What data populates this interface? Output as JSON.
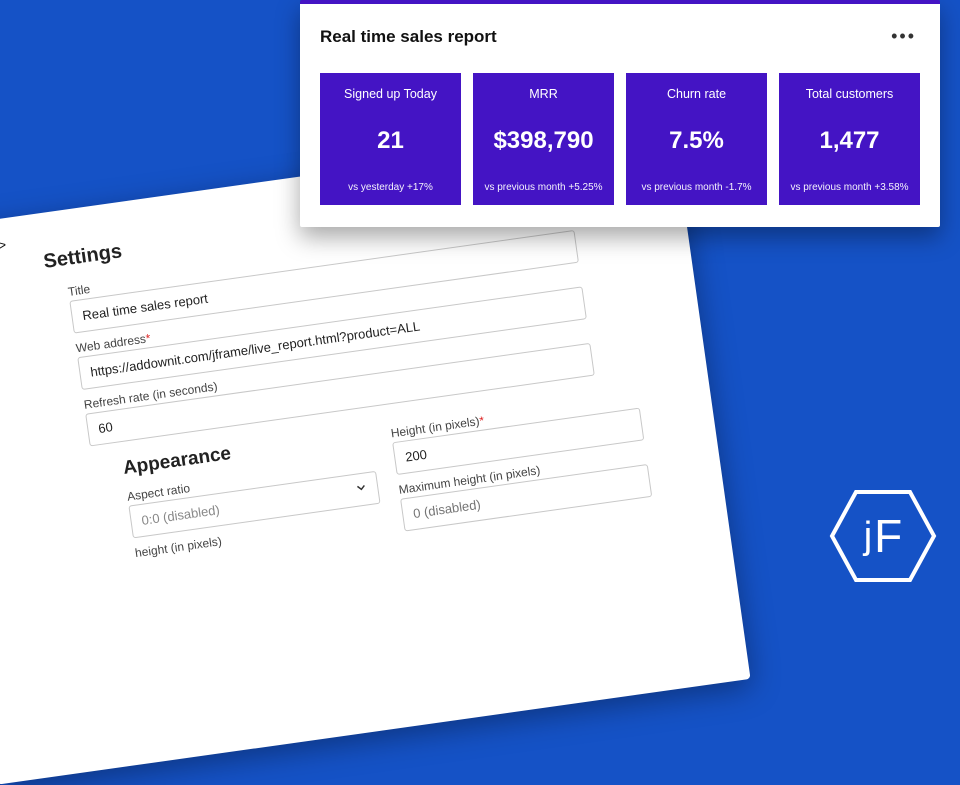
{
  "settings": {
    "tag": "<jframe>",
    "heading": "Settings",
    "title_label": "Title",
    "title_value": "Real time sales report",
    "url_label": "Web address",
    "url_required": "*",
    "url_value": "https://addownit.com/jframe/live_report.html?product=ALL",
    "refresh_label": "Refresh rate (in seconds)",
    "refresh_value": "60",
    "appearance_heading": "Appearance",
    "aspect_label": "Aspect ratio",
    "aspect_value": "0:0 (disabled)",
    "min_height_label": "height (in pixels)",
    "height_label": "Height (in pixels)",
    "height_required": "*",
    "height_value": "200",
    "max_height_label": "Maximum height (in pixels)",
    "max_height_placeholder": "0 (disabled)"
  },
  "report": {
    "title": "Real time sales report",
    "stats": [
      {
        "label": "Signed up Today",
        "value": "21",
        "compare": "vs yesterday +17%"
      },
      {
        "label": "MRR",
        "value": "$398,790",
        "compare": "vs previous month +5.25%"
      },
      {
        "label": "Churn rate",
        "value": "7.5%",
        "compare": "vs previous month -1.7%"
      },
      {
        "label": "Total customers",
        "value": "1,477",
        "compare": "vs previous month +3.58%"
      }
    ]
  },
  "logo": {
    "j": "j",
    "F": "F"
  }
}
